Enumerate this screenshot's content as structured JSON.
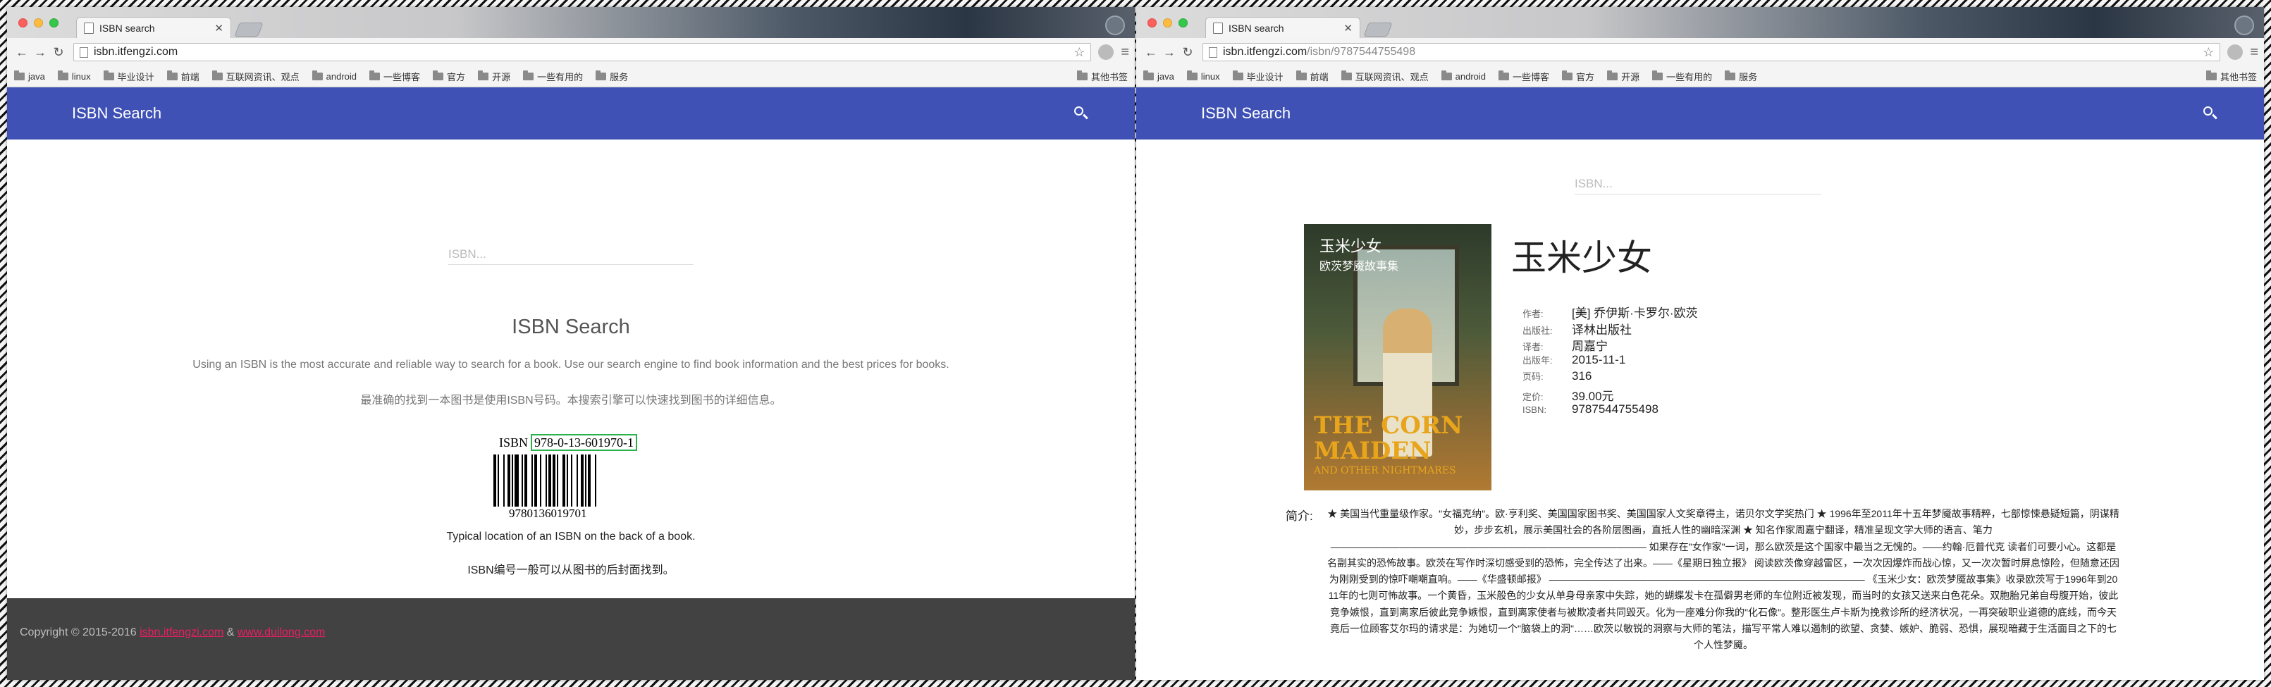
{
  "left": {
    "tab_title": "ISBN search",
    "url_host": "isbn.itfengzi.com",
    "url_path": "",
    "bookmarks": [
      "java",
      "linux",
      "毕业设计",
      "前端",
      "互联网资讯、观点",
      "android",
      "一些博客",
      "官方",
      "开源",
      "一些有用的",
      "服务"
    ],
    "other_bookmarks": "其他书签",
    "app_title": "ISBN Search",
    "isbn_placeholder": "ISBN...",
    "hero_title": "ISBN Search",
    "hero_desc_en": "Using an ISBN is the most accurate and reliable way to search for a book. Use our search engine to find book information and the best prices for books.",
    "hero_desc_zh": "最准确的找到一本图书是使用ISBN号码。本搜索引擎可以快速找到图书的详细信息。",
    "barcode_prefix": "ISBN",
    "barcode_isbn": "978-0-13-601970-1",
    "barcode_digits": "9780136019701",
    "caption_en": "Typical location of an ISBN on the back of a book.",
    "caption_zh": "ISBN编号一般可以从图书的后封面找到。",
    "footer_copyright": "Copyright © 2015-2016 ",
    "footer_link1": "isbn.itfengzi.com",
    "footer_amp": " & ",
    "footer_link2": "www.duilong.com"
  },
  "right": {
    "tab_title": "ISBN search",
    "url_host": "isbn.itfengzi.com",
    "url_path": "/isbn/9787544755498",
    "bookmarks": [
      "java",
      "linux",
      "毕业设计",
      "前端",
      "互联网资讯、观点",
      "android",
      "一些博客",
      "官方",
      "开源",
      "一些有用的",
      "服务"
    ],
    "other_bookmarks": "其他书签",
    "app_title": "ISBN Search",
    "isbn_placeholder": "ISBN...",
    "cover": {
      "title_cn": "玉米少女",
      "subtitle_cn": "欧茨梦魇故事集",
      "title_en": "THE CORN MAIDEN",
      "subtitle_en": "AND OTHER NIGHTMARES"
    },
    "book_title": "玉米少女",
    "meta": [
      {
        "label": "作者:",
        "value": "[美] 乔伊斯·卡罗尔·欧茨"
      },
      {
        "label": "出版社:",
        "value": "译林出版社"
      },
      {
        "label": "译者:",
        "value": "周嘉宁"
      },
      {
        "label": "出版年:",
        "value": "2015-11-1"
      },
      {
        "label": "页码:",
        "value": "316"
      },
      {
        "label": "定价:",
        "value": "39.00元"
      },
      {
        "label": "ISBN:",
        "value": "9787544755498"
      }
    ],
    "summary_label": "简介:",
    "summary_text": "★ 美国当代重量级作家。\"女福克纳\"。欧·亨利奖、美国国家图书奖、美国国家人文奖章得主，诺贝尔文学奖热门 ★ 1996年至2011年十五年梦魇故事精粹，七部惊悚悬疑短篇，阴谋精妙，步步玄机，展示美国社会的各阶层图画，直抵人性的幽暗深渊 ★ 知名作家周嘉宁翻译，精准呈现文学大师的语言、笔力 ———————————————————————————————— 如果存在\"女作家\"一词，那么欧茨是这个国家中最当之无愧的。——约翰·厄普代克 读者们可要小心。这都是名副其实的恐怖故事。欧茨在写作时深切感受到的恐怖，完全传达了出来。——《星期日独立报》 阅读欧茨像穿越雷区，一次次因爆炸而战心惊，又一次次暂时屏息惊险，但随意还因为刚刚受到的惊吓嘲嘲直响。——《华盛顿邮报》 ———————————————————————————————— 《玉米少女：欧茨梦魇故事集》收录欧茨写于1996年到2011年的七则可怖故事。一个黄昏，玉米般色的少女从单身母亲家中失踪，她的蝴蝶发卡在孤僻男老师的车位附近被发现，而当时的女孩又送来白色花朵。双胞胎兄弟自母腹开始，彼此竞争嫉恨，直到离家后彼此竞争嫉恨，直到离家使者与被欺凌者共同毁灭。化为一座难分你我的\"化石像\"。整形医生卢卡斯为挽救诊所的经济状况，一再突破职业道德的底线，而今天竟后一位顾客艾尔玛的请求是：为她切一个\"脑袋上的洞\"……欧茨以敏锐的洞察与大师的笔法，描写平常人难以遏制的欲望、贪婪、嫉妒、脆弱、恐惧，展现暗藏于生活面目之下的七个人性梦魇。"
  },
  "icons": {
    "back": "back-arrow-icon",
    "forward": "forward-arrow-icon",
    "reload": "reload-icon",
    "star": "star-icon",
    "menu": "hamburger-menu-icon",
    "search": "search-icon",
    "folder": "folder-icon"
  },
  "colors": {
    "appbar": "#3f51b5",
    "footer": "#424242",
    "link": "#e91e63",
    "barcode_highlight": "#2bb24c"
  }
}
